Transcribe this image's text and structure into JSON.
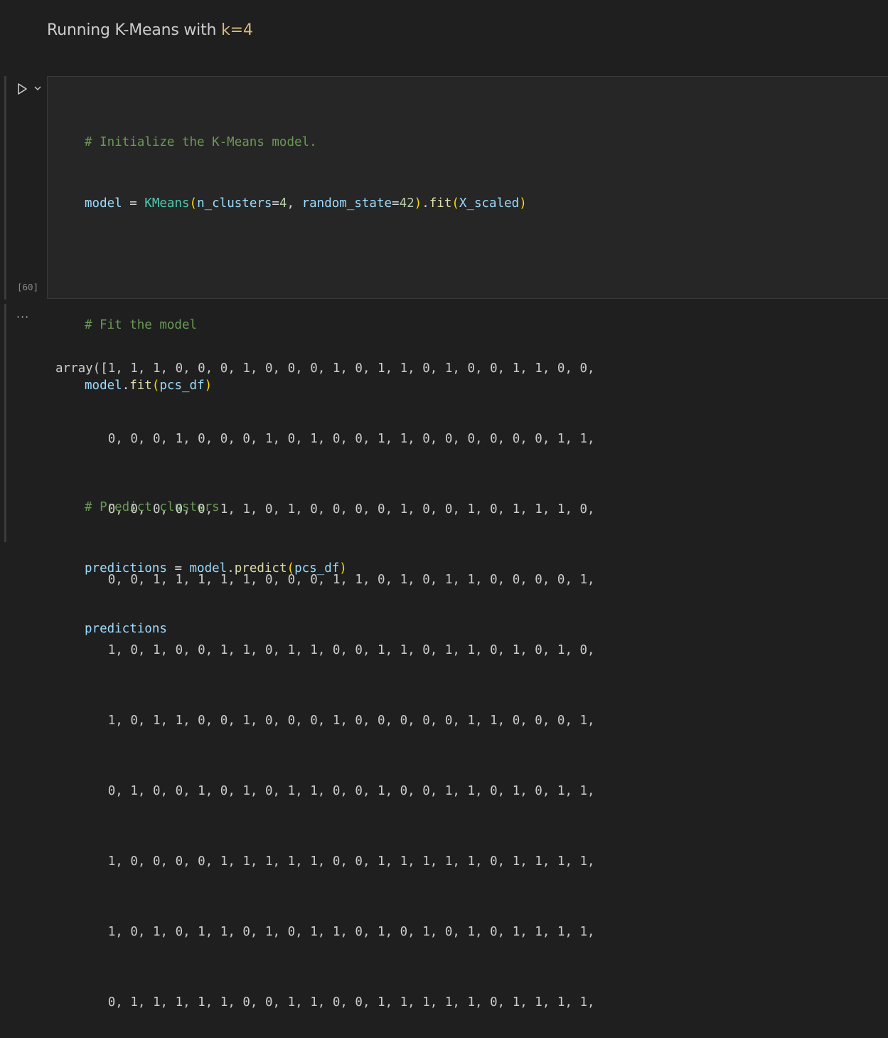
{
  "markdown": {
    "title_text": "Running K-Means with ",
    "title_code": "k=4"
  },
  "cell": {
    "execution_count": "[60]",
    "run_icon": "play-icon",
    "menu_icon": "chevron-down-icon",
    "code_lines": [
      "# Initialize the K-Means model.",
      "model = KMeans(n_clusters=4, random_state=42).fit(X_scaled)",
      "",
      "# Fit the model",
      "model.fit(pcs_df)",
      "",
      "# Predict clusters",
      "predictions = model.predict(pcs_df)",
      "predictions"
    ]
  },
  "output": {
    "more_label": "···",
    "lines": [
      "array([1, 1, 1, 0, 0, 0, 1, 0, 0, 0, 1, 0, 1, 1, 0, 1, 0, 0, 1, 1, 0, 0,",
      "       0, 0, 0, 1, 0, 0, 0, 1, 0, 1, 0, 0, 1, 1, 0, 0, 0, 0, 0, 0, 1, 1,",
      "       0, 0, 0, 0, 0, 1, 1, 0, 1, 0, 0, 0, 0, 1, 0, 0, 1, 0, 1, 1, 1, 0,",
      "       0, 0, 1, 1, 1, 1, 1, 0, 0, 0, 1, 1, 0, 1, 0, 1, 1, 0, 0, 0, 0, 1,",
      "       1, 0, 1, 0, 0, 1, 1, 0, 1, 1, 0, 0, 1, 1, 0, 1, 1, 0, 1, 0, 1, 0,",
      "       1, 0, 1, 1, 0, 0, 1, 0, 0, 0, 1, 0, 0, 0, 0, 0, 1, 1, 0, 0, 0, 1,",
      "       0, 1, 0, 0, 1, 0, 1, 0, 1, 1, 0, 0, 1, 0, 0, 1, 1, 0, 1, 0, 1, 1,",
      "       1, 0, 0, 0, 0, 1, 1, 1, 1, 1, 0, 0, 1, 1, 1, 1, 1, 0, 1, 1, 1, 1,",
      "       1, 0, 1, 0, 1, 1, 0, 1, 0, 1, 1, 0, 1, 0, 1, 0, 1, 0, 1, 1, 1, 1,",
      "       0, 1, 1, 1, 1, 1, 0, 0, 1, 1, 0, 0, 1, 1, 1, 1, 1, 0, 1, 1, 1, 1,"
    ]
  },
  "colors": {
    "background": "#1f1f1f",
    "cell_background": "#262626",
    "comment": "#6a9955",
    "variable": "#9cdcfe",
    "function": "#dcdcaa",
    "class": "#4ec9b0",
    "number": "#b5cea8",
    "bracket": "#ffd700",
    "inline_code": "#d7ba7d"
  }
}
